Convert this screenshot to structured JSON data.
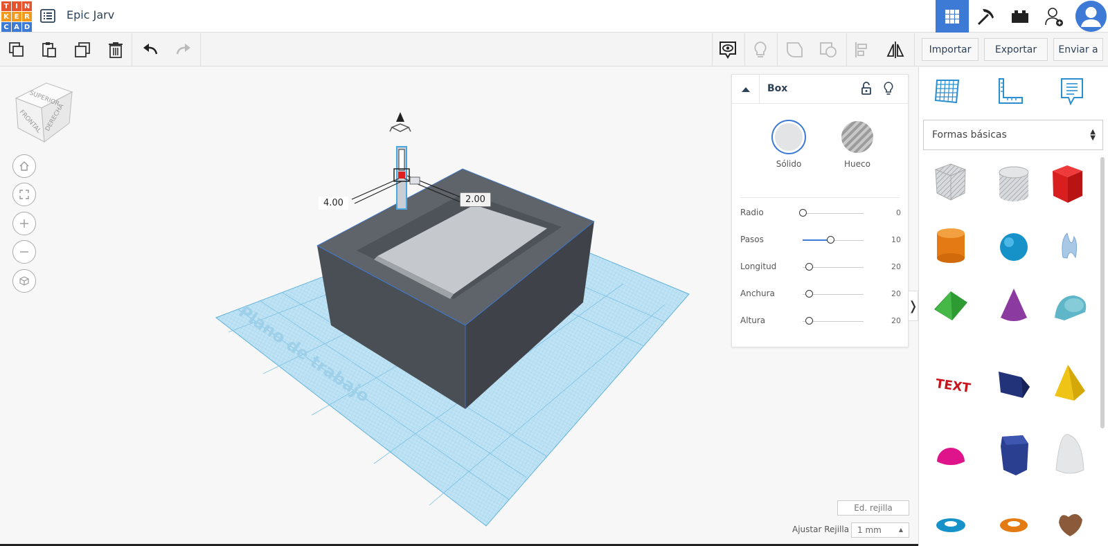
{
  "app": {
    "logo_letters": [
      "T",
      "I",
      "N",
      "K",
      "E",
      "R",
      "C",
      "A",
      "D"
    ],
    "logo_colors": [
      "#e8532f",
      "#e8532f",
      "#e8532f",
      "#f29a1e",
      "#f29a1e",
      "#f29a1e",
      "#3c7ad6",
      "#3c7ad6",
      "#3c7ad6"
    ],
    "design_title": "Epic Jarv",
    "accent_color": "#3c7ad6"
  },
  "topbar": {
    "view_buttons": [
      {
        "name": "3d-design-view",
        "icon": "grid-icon",
        "active": true
      },
      {
        "name": "blocks-view",
        "icon": "pickaxe-icon",
        "active": false
      },
      {
        "name": "bricks-view",
        "icon": "brick-icon",
        "active": false
      },
      {
        "name": "add-user",
        "icon": "add-user-icon",
        "active": false
      }
    ]
  },
  "toolbar": {
    "left_tools": [
      "copy",
      "paste",
      "duplicate",
      "delete",
      "undo",
      "redo"
    ],
    "right_tools": [
      "show-notes",
      "light",
      "group",
      "ungroup",
      "align",
      "mirror"
    ],
    "import_label": "Importar",
    "export_label": "Exportar",
    "send_label": "Enviar a"
  },
  "viewcube": {
    "top": "SUPERIOR",
    "front": "FRONTAL",
    "right": "DERECHA"
  },
  "workplane": {
    "label": "Plano de trabajo",
    "dim_left": "4.00",
    "dim_right": "2.00"
  },
  "inspector": {
    "shape_name": "Box",
    "solid_label": "Sólido",
    "hole_label": "Hueco",
    "properties": [
      {
        "label": "Radio",
        "value": "0",
        "fraction": 0.0
      },
      {
        "label": "Pasos",
        "value": "10",
        "fraction": 0.45
      },
      {
        "label": "Longitud",
        "value": "20",
        "fraction": 0.1
      },
      {
        "label": "Anchura",
        "value": "20",
        "fraction": 0.1
      },
      {
        "label": "Altura",
        "value": "20",
        "fraction": 0.1
      }
    ]
  },
  "library": {
    "category": "Formas básicas",
    "shapes": [
      "box-hole",
      "cylinder-hole",
      "box",
      "cylinder",
      "sphere",
      "scribble",
      "roof",
      "cone",
      "round-roof",
      "text",
      "wedge",
      "pyramid",
      "half-sphere",
      "polygon",
      "paraboloid",
      "torus",
      "tube",
      "heart"
    ]
  },
  "grid": {
    "edit_label": "Ed. rejilla",
    "snap_label": "Ajustar Rejilla",
    "snap_value": "1 mm"
  }
}
